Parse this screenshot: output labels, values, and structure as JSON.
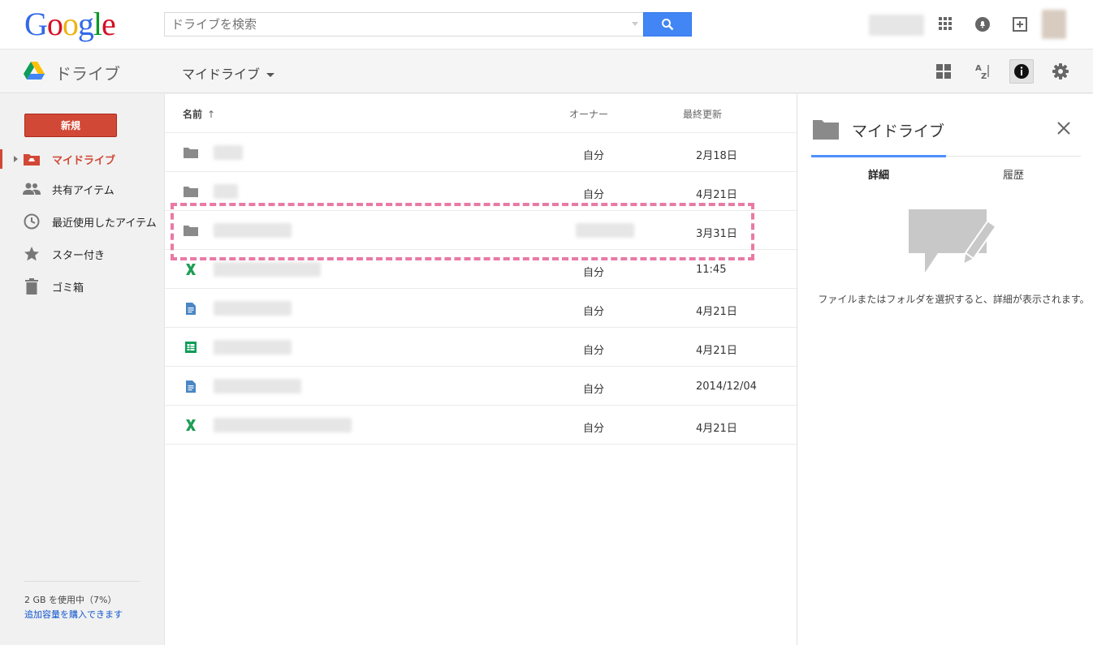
{
  "header": {
    "logo": "Google",
    "search": {
      "placeholder": "ドライブを検索",
      "value": ""
    }
  },
  "subbar": {
    "app_title": "ドライブ",
    "location": "マイドライブ"
  },
  "sidebar": {
    "new_button": "新規",
    "items": [
      {
        "label": "マイドライブ",
        "icon": "drive-folder-icon",
        "active": true
      },
      {
        "label": "共有アイテム",
        "icon": "people-icon"
      },
      {
        "label": "最近使用したアイテム",
        "icon": "clock-icon"
      },
      {
        "label": "スター付き",
        "icon": "star-icon"
      },
      {
        "label": "ゴミ箱",
        "icon": "trash-icon"
      }
    ],
    "storage_text": "2 GB を使用中（7%）",
    "storage_link": "追加容量を購入できます"
  },
  "list": {
    "col_name": "名前",
    "sort_indicator": "↑",
    "col_owner": "オーナー",
    "col_modified": "最終更新",
    "rows": [
      {
        "type": "folder",
        "owner": "自分",
        "modified": "2月18日"
      },
      {
        "type": "folder",
        "owner": "自分",
        "modified": "4月21日"
      },
      {
        "type": "folder",
        "owner": "",
        "modified": "3月31日"
      },
      {
        "type": "excel",
        "owner": "自分",
        "modified": "11:45"
      },
      {
        "type": "doc",
        "owner": "自分",
        "modified": "4月21日"
      },
      {
        "type": "sheet",
        "owner": "自分",
        "modified": "4月21日"
      },
      {
        "type": "doc",
        "owner": "自分",
        "modified": "2014/12/04"
      },
      {
        "type": "excel",
        "owner": "自分",
        "modified": "4月21日"
      }
    ]
  },
  "details": {
    "title": "マイドライブ",
    "tabs": [
      "詳細",
      "履歴"
    ],
    "message": "ファイルまたはフォルダを選択すると、詳細が表示されます。"
  },
  "colors": {
    "accent_red": "#d14836",
    "search_blue": "#4285f4",
    "tab_blue": "#4d90fe",
    "highlight_pink": "#e87aa5",
    "excel_green": "#1e9e55",
    "doc_blue": "#4a86c5",
    "sheet_green": "#0f9d58"
  }
}
